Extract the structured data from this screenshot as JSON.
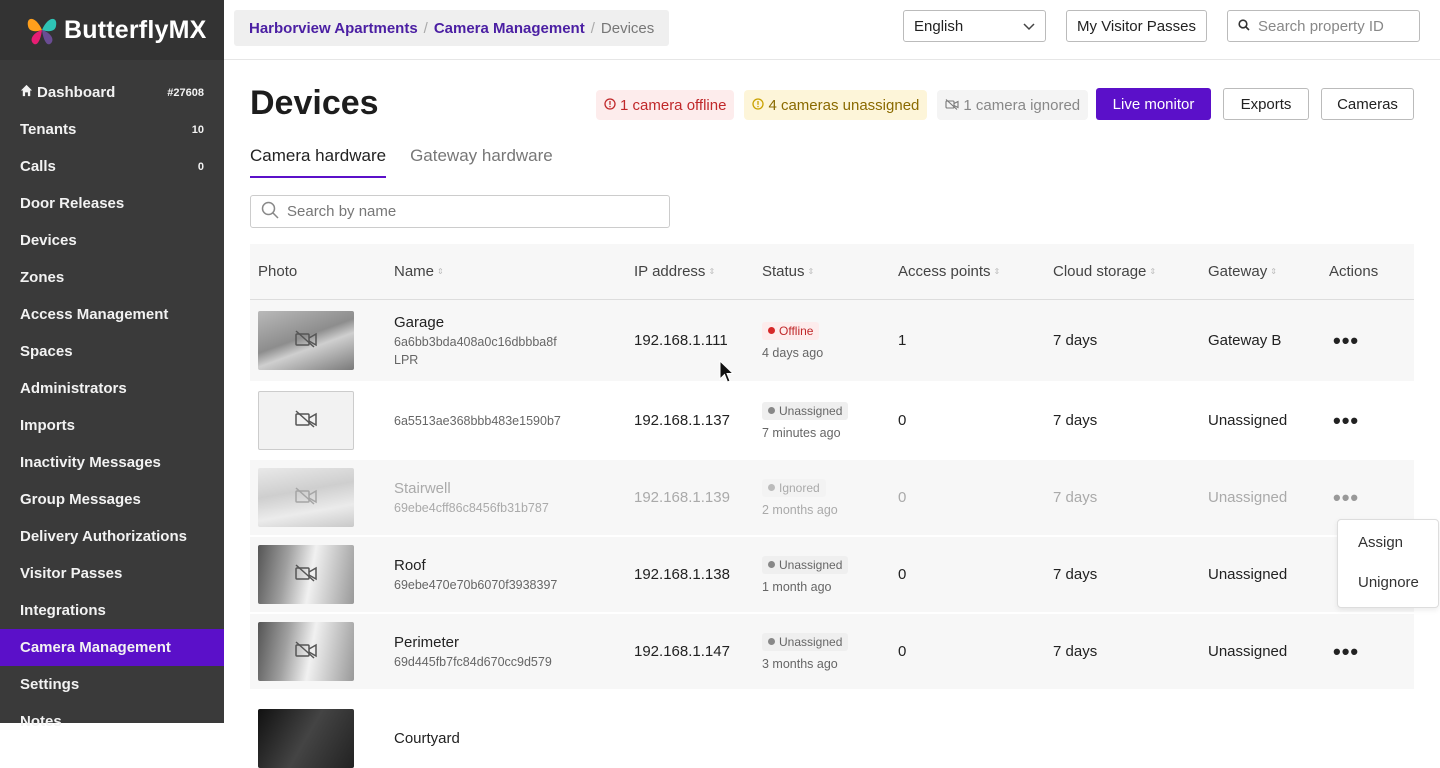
{
  "app": {
    "name": "ButterflyMX"
  },
  "sidebar": {
    "property_id": "#27608",
    "items": [
      {
        "label": "Dashboard",
        "count": "#27608"
      },
      {
        "label": "Tenants",
        "count": "10"
      },
      {
        "label": "Calls",
        "count": "0"
      },
      {
        "label": "Door Releases",
        "count": ""
      },
      {
        "label": "Devices",
        "count": ""
      },
      {
        "label": "Zones",
        "count": ""
      },
      {
        "label": "Access Management",
        "count": ""
      },
      {
        "label": "Spaces",
        "count": ""
      },
      {
        "label": "Administrators",
        "count": ""
      },
      {
        "label": "Imports",
        "count": ""
      },
      {
        "label": "Inactivity Messages",
        "count": ""
      },
      {
        "label": "Group Messages",
        "count": ""
      },
      {
        "label": "Delivery Authorizations",
        "count": ""
      },
      {
        "label": "Visitor Passes",
        "count": ""
      },
      {
        "label": "Integrations",
        "count": ""
      },
      {
        "label": "Camera Management",
        "count": "",
        "active": true
      },
      {
        "label": "Settings",
        "count": ""
      },
      {
        "label": "Notes",
        "count": ""
      }
    ]
  },
  "topbar": {
    "breadcrumb": [
      "Harborview Apartments",
      "Camera Management",
      "Devices"
    ],
    "language": "English",
    "visitor_passes_label": "My Visitor Passes",
    "property_search_placeholder": "Search property ID"
  },
  "page": {
    "title": "Devices",
    "pills": {
      "offline": "1 camera offline",
      "unassigned": "4 cameras unassigned",
      "ignored": "1 camera ignored"
    },
    "live_monitor_label": "Live monitor",
    "exports_label": "Exports",
    "cameras_label": "Cameras",
    "tabs": [
      "Camera hardware",
      "Gateway hardware"
    ],
    "name_search_placeholder": "Search by name"
  },
  "table": {
    "headers": [
      "Photo",
      "Name",
      "IP address",
      "Status",
      "Access points",
      "Cloud storage",
      "Gateway",
      "Actions"
    ],
    "rows": [
      {
        "name": "Garage",
        "id": "6a6bb3bda408a0c16dbbba8f",
        "extra": "LPR",
        "ip": "192.168.1.111",
        "status": "Offline",
        "status_time": "4 days ago",
        "access_points": "1",
        "cloud": "7 days",
        "gateway": "Gateway B"
      },
      {
        "name": "",
        "id": "6a5513ae368bbb483e1590b7",
        "extra": "",
        "ip": "192.168.1.137",
        "status": "Unassigned",
        "status_time": "7 minutes ago",
        "access_points": "0",
        "cloud": "7 days",
        "gateway": "Unassigned"
      },
      {
        "name": "Stairwell",
        "id": "69ebe4cff86c8456fb31b787",
        "extra": "",
        "ip": "192.168.1.139",
        "status": "Ignored",
        "status_time": "2 months ago",
        "access_points": "0",
        "cloud": "7 days",
        "gateway": "Unassigned"
      },
      {
        "name": "Roof",
        "id": "69ebe470e70b6070f3938397",
        "extra": "",
        "ip": "192.168.1.138",
        "status": "Unassigned",
        "status_time": "1 month ago",
        "access_points": "0",
        "cloud": "7 days",
        "gateway": "Unassigned"
      },
      {
        "name": "Perimeter",
        "id": "69d445fb7fc84d670cc9d579",
        "extra": "",
        "ip": "192.168.1.147",
        "status": "Unassigned",
        "status_time": "3 months ago",
        "access_points": "0",
        "cloud": "7 days",
        "gateway": "Unassigned"
      },
      {
        "name": "Courtyard",
        "id": "",
        "extra": "",
        "ip": "",
        "status": "",
        "status_time": "",
        "access_points": "",
        "cloud": "",
        "gateway": ""
      }
    ]
  },
  "dropdown": {
    "items": [
      "Assign",
      "Unignore"
    ]
  },
  "colors": {
    "accent": "#5b10c9",
    "sidebar_bg": "#3a3a3a",
    "offline": "#d62828",
    "link": "#4b1fa3"
  },
  "icons": {
    "home": "home-icon",
    "camera_off": "camera-off-icon",
    "search": "search-icon",
    "chevron": "chevron-down-icon",
    "more": "more-horizontal-icon"
  }
}
